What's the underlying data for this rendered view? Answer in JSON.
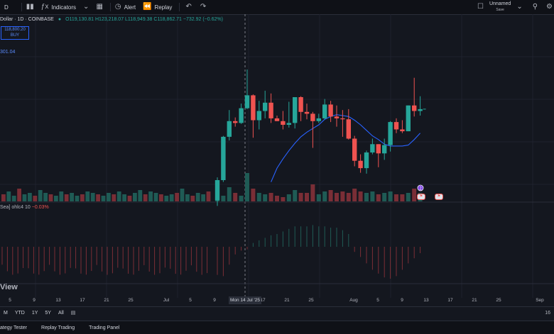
{
  "toolbar": {
    "interval": "D",
    "indicators_label": "Indicators",
    "alert_label": "Alert",
    "replay_label": "Replay",
    "layout_name": "Unnamed",
    "layout_status": "Save"
  },
  "legend": {
    "symbol": "Dollar · 1D · COINBASE",
    "ohlc": "O119,130.81 H123,218.07 L118,949.38 C118,862.71 −732.92 (−0.62%)"
  },
  "price_tag": {
    "line1": "118,800.20",
    "line2": "BUY"
  },
  "price_level": "301.04",
  "indicator": {
    "name": "Sea] ohlc4 10",
    "value": "−0.03%"
  },
  "watermark": "View",
  "crosshair_date": "Mon 14 Jul '25",
  "x_labels": [
    "5",
    "9",
    "13",
    "17",
    "21",
    "25",
    "Jul",
    "5",
    "9",
    "17",
    "21",
    "25",
    "Aug",
    "5",
    "9",
    "13",
    "17",
    "21",
    "25",
    "Sep"
  ],
  "range_buttons": [
    "M",
    "YTD",
    "1Y",
    "5Y",
    "All"
  ],
  "right_corner_label": "16",
  "bottom_tabs": [
    "ategy Tester",
    "Replay Trading",
    "Trading Panel"
  ],
  "event_badge": "2",
  "colors": {
    "up": "#26a69a",
    "down": "#ef5350",
    "ma": "#2962ff",
    "bg": "#14171f"
  },
  "chart_data": {
    "type": "candlestick",
    "title": "",
    "xlabel": "",
    "ylabel": "",
    "candles": [
      {
        "d": "07-09",
        "o": 109,
        "h": 111.5,
        "l": 108.4,
        "c": 111.2
      },
      {
        "d": "07-10",
        "o": 111.2,
        "h": 116,
        "l": 111,
        "c": 115.9
      },
      {
        "d": "07-11",
        "o": 115.9,
        "h": 118.8,
        "l": 115.5,
        "c": 117.6
      },
      {
        "d": "07-12",
        "o": 117.6,
        "h": 118,
        "l": 117,
        "c": 117.4
      },
      {
        "d": "07-13",
        "o": 117.4,
        "h": 119.5,
        "l": 117.3,
        "c": 119
      },
      {
        "d": "07-14",
        "o": 119,
        "h": 123.2,
        "l": 118.9,
        "c": 120.4
      },
      {
        "d": "07-15",
        "o": 120.4,
        "h": 120.5,
        "l": 115.8,
        "c": 117.7
      },
      {
        "d": "07-16",
        "o": 117.7,
        "h": 119.8,
        "l": 116.7,
        "c": 118.7
      },
      {
        "d": "07-17",
        "o": 118.7,
        "h": 120.9,
        "l": 117.9,
        "c": 119.6
      },
      {
        "d": "07-18",
        "o": 119.6,
        "h": 120.6,
        "l": 117.4,
        "c": 117.9
      },
      {
        "d": "07-19",
        "o": 117.9,
        "h": 118.2,
        "l": 117.6,
        "c": 117.6
      },
      {
        "d": "07-20",
        "o": 117.6,
        "h": 118.7,
        "l": 116.7,
        "c": 117.2
      },
      {
        "d": "07-21",
        "o": 117.2,
        "h": 119.7,
        "l": 116.9,
        "c": 117.4
      },
      {
        "d": "07-22",
        "o": 117.4,
        "h": 120.2,
        "l": 116.8,
        "c": 120.2
      },
      {
        "d": "07-23",
        "o": 120.2,
        "h": 120.3,
        "l": 117.6,
        "c": 118.6
      },
      {
        "d": "07-24",
        "o": 118.6,
        "h": 119.5,
        "l": 117.8,
        "c": 118.4
      },
      {
        "d": "07-25",
        "o": 118.4,
        "h": 118.6,
        "l": 114.7,
        "c": 117.6
      },
      {
        "d": "07-26",
        "o": 117.6,
        "h": 118.4,
        "l": 117.4,
        "c": 117.9
      },
      {
        "d": "07-27",
        "o": 117.9,
        "h": 120,
        "l": 117.8,
        "c": 119.4
      },
      {
        "d": "07-28",
        "o": 119.4,
        "h": 119.8,
        "l": 117.5,
        "c": 118.1
      },
      {
        "d": "07-29",
        "o": 118.1,
        "h": 119.3,
        "l": 117,
        "c": 117.9
      },
      {
        "d": "07-30",
        "o": 117.9,
        "h": 118.8,
        "l": 115.9,
        "c": 117.8
      },
      {
        "d": "07-31",
        "o": 117.8,
        "h": 118.9,
        "l": 115.6,
        "c": 115.7
      },
      {
        "d": "08-01",
        "o": 115.7,
        "h": 116,
        "l": 112.7,
        "c": 113.3
      },
      {
        "d": "08-02",
        "o": 113.3,
        "h": 114,
        "l": 112,
        "c": 112.5
      },
      {
        "d": "08-03",
        "o": 112.5,
        "h": 114.4,
        "l": 111.9,
        "c": 114.2
      },
      {
        "d": "08-04",
        "o": 114.2,
        "h": 115.7,
        "l": 114,
        "c": 115.1
      },
      {
        "d": "08-05",
        "o": 115.1,
        "h": 115.1,
        "l": 112.6,
        "c": 114.1
      },
      {
        "d": "08-06",
        "o": 114.1,
        "h": 115.7,
        "l": 113.4,
        "c": 115
      },
      {
        "d": "08-07",
        "o": 115,
        "h": 117.6,
        "l": 114.3,
        "c": 117.5
      },
      {
        "d": "08-08",
        "o": 117.5,
        "h": 117.9,
        "l": 116.3,
        "c": 116.7
      },
      {
        "d": "08-09",
        "o": 116.7,
        "h": 117.7,
        "l": 116.3,
        "c": 116.5
      },
      {
        "d": "08-10",
        "o": 116.5,
        "h": 119.3,
        "l": 116.5,
        "c": 119.3
      },
      {
        "d": "08-11",
        "o": 119.3,
        "h": 122.3,
        "l": 118.1,
        "c": 118.7
      },
      {
        "d": "08-12",
        "o": 118.7,
        "h": 120.3,
        "l": 118.2,
        "c": 118.9
      }
    ],
    "ma": [
      null,
      null,
      null,
      null,
      null,
      null,
      null,
      null,
      null,
      111,
      112.5,
      113.5,
      114.4,
      115.2,
      115.9,
      116.4,
      116.8,
      117.2,
      117.8,
      118.1,
      118.3,
      118.2,
      118.1,
      117.7,
      117.2,
      116.6,
      116,
      115.6,
      115.1,
      114.9,
      114.9,
      114.9,
      115,
      115.6,
      116.3
    ],
    "volume": [
      3,
      4,
      10,
      6,
      4,
      20,
      9,
      6,
      5,
      6,
      4,
      3,
      5,
      8,
      6,
      6,
      12,
      5,
      7,
      8,
      6,
      7,
      6,
      9,
      7,
      6,
      7,
      5,
      6,
      7,
      5,
      5,
      6,
      9,
      6
    ],
    "oscillator": [
      -2.2,
      -2.3,
      -1.4,
      -0.6,
      -0.3,
      -0.2,
      0.3,
      0.5,
      0.7,
      0.9,
      1.0,
      1.2,
      1.4,
      1.6,
      1.6,
      1.6,
      1.7,
      1.6,
      1.6,
      1.5,
      1.5,
      1.3,
      1.0,
      -0.4,
      -0.8,
      -1.3,
      -1.8,
      -2.1,
      -2.4,
      -2.5,
      -2.3,
      -1.8,
      -1.3,
      -0.9,
      -0.5
    ]
  }
}
